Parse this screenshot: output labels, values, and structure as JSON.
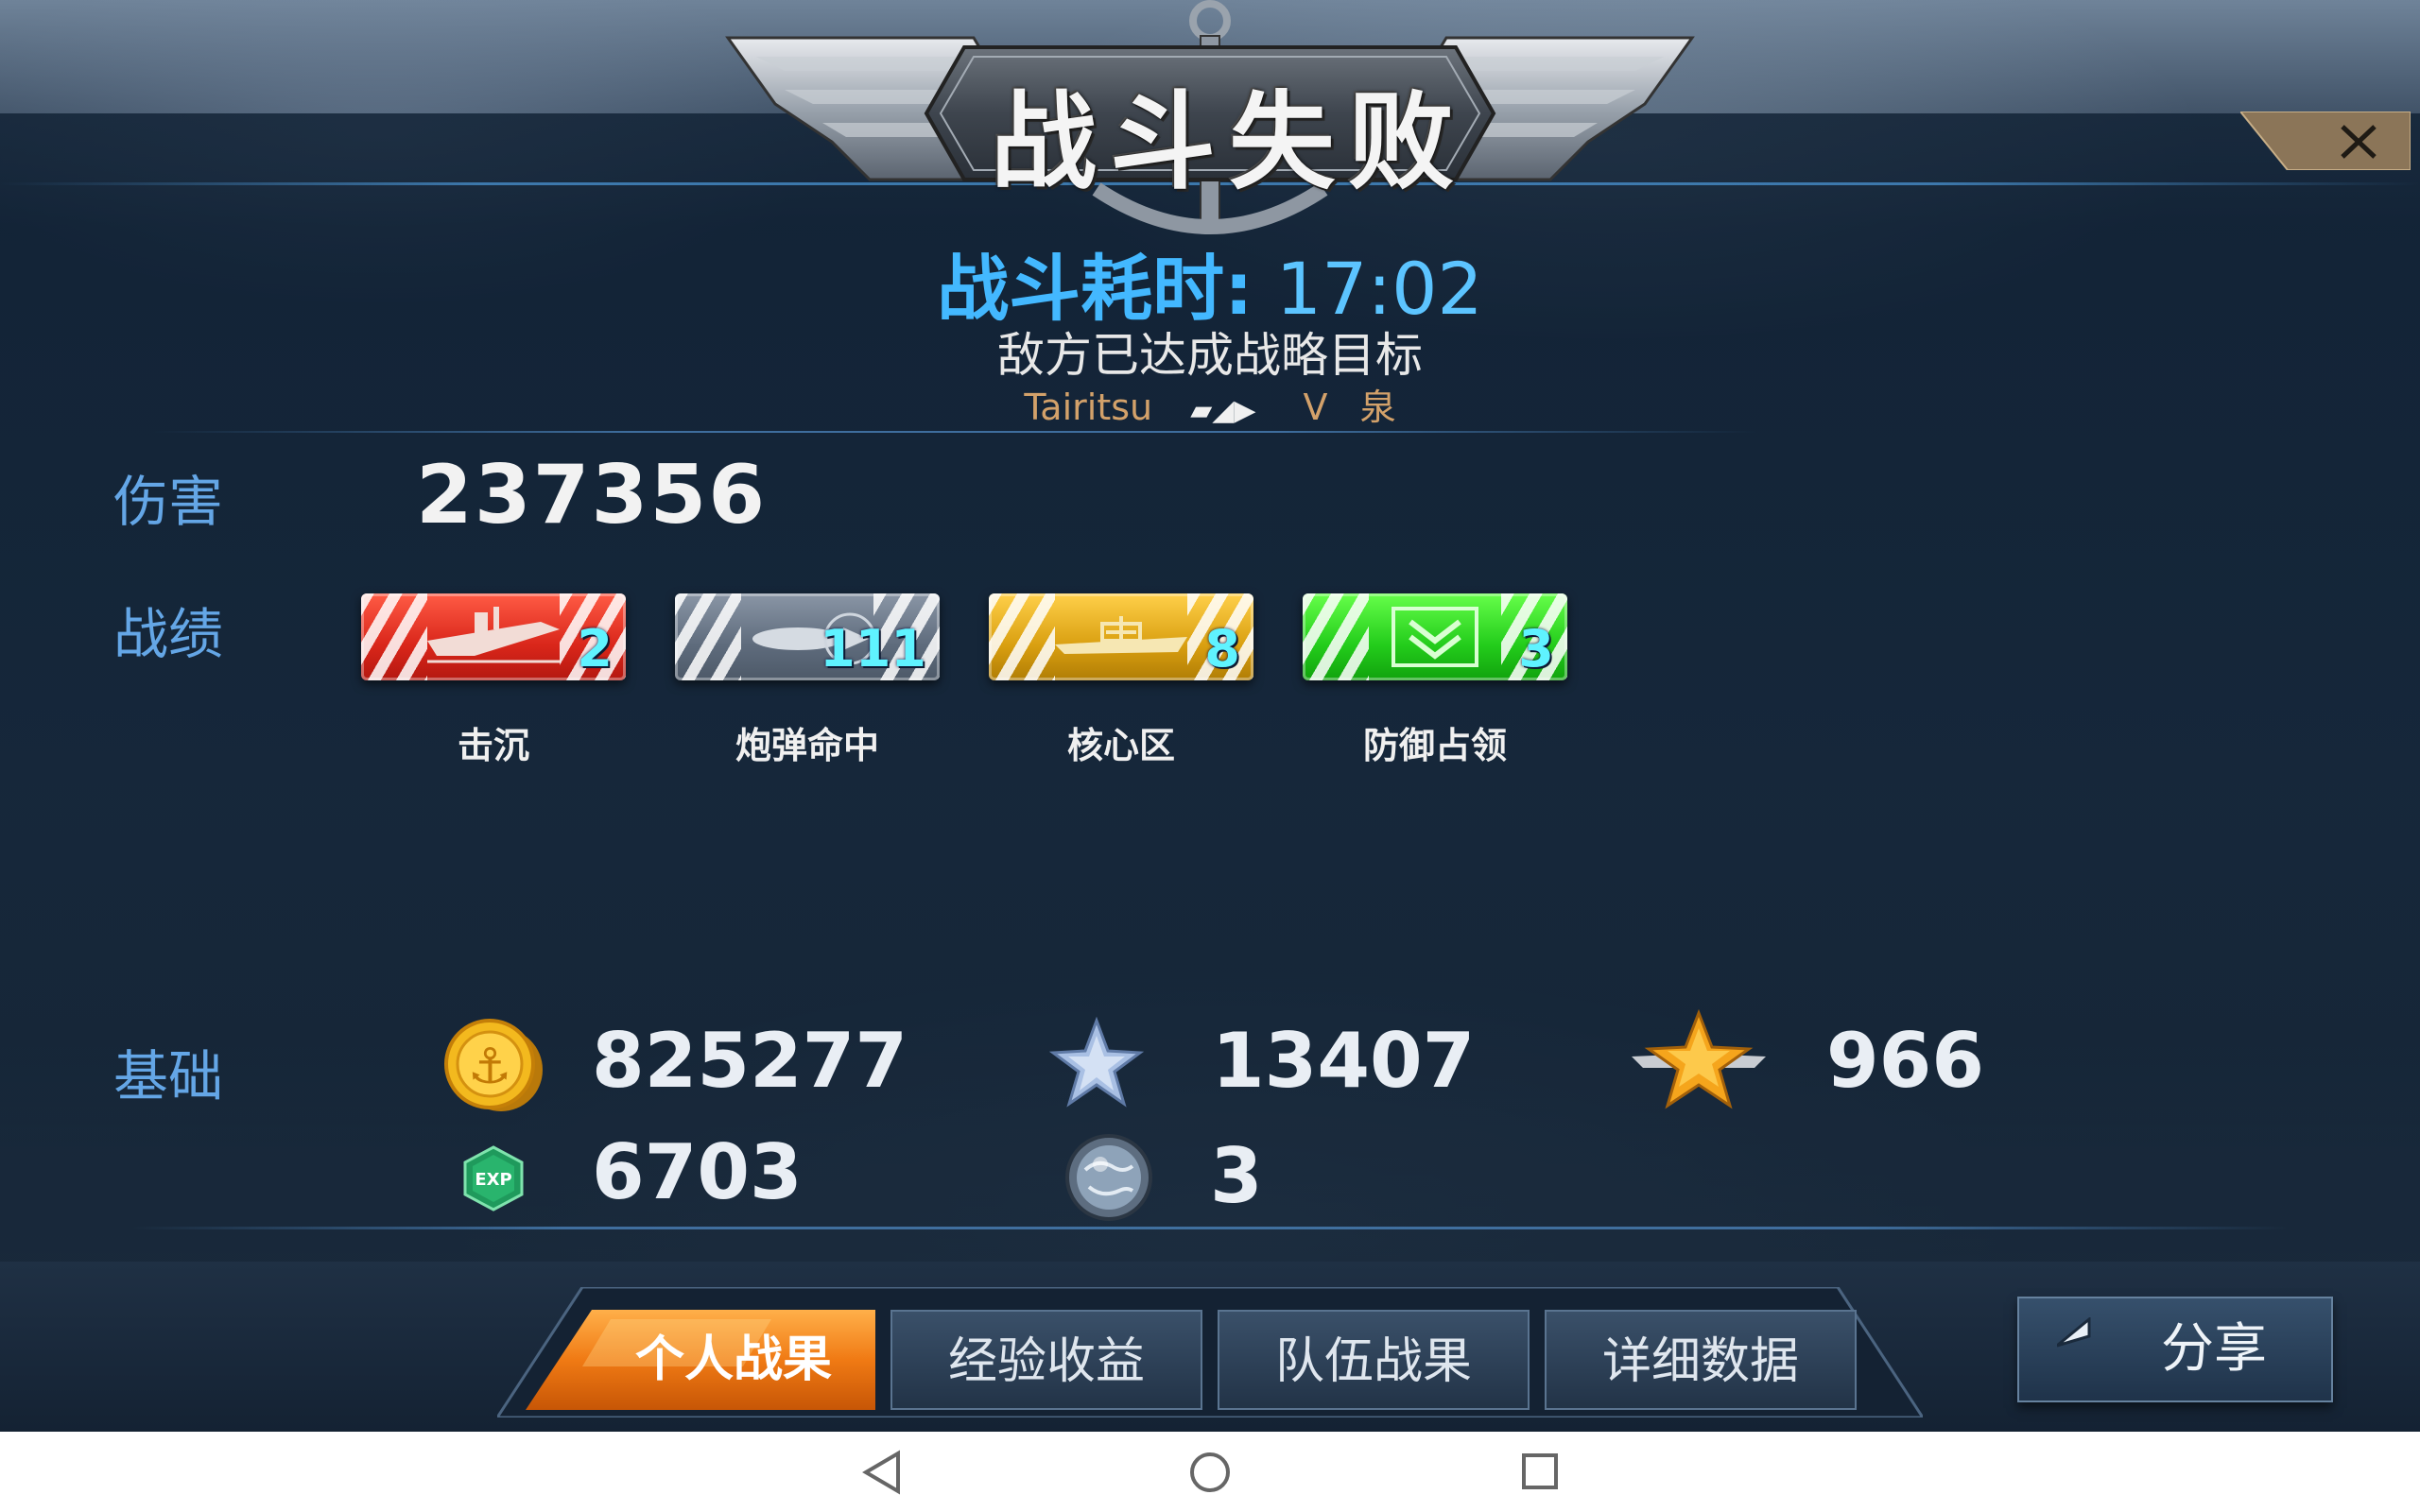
{
  "header": {
    "title": "战斗失败"
  },
  "battle": {
    "duration_label": "战斗耗时:",
    "duration_value": "17:02",
    "result_reason": "敌方已达成战略目标",
    "player_name": "Tairitsu",
    "vs_label": "V",
    "opponent_name": "泉"
  },
  "damage": {
    "label": "伤害",
    "value": "237356"
  },
  "achievements": {
    "label": "战绩",
    "items": [
      {
        "name": "击沉",
        "count": "2",
        "color": "#e0281c",
        "icon": "sinking-ship-icon"
      },
      {
        "name": "炮弹命中",
        "count": "111",
        "color": "#6a7686",
        "icon": "shell-hit-icon"
      },
      {
        "name": "核心区",
        "count": "8",
        "color": "#e1a714",
        "icon": "core-zone-icon"
      },
      {
        "name": "防御占领",
        "count": "3",
        "color": "#2ad21f",
        "icon": "defense-capture-icon"
      }
    ]
  },
  "basics": {
    "label": "基础",
    "gold": {
      "icon": "gold-coin-icon",
      "value": "825277"
    },
    "silver_star": {
      "icon": "silver-star-icon",
      "value": "13407"
    },
    "gold_star": {
      "icon": "gold-winged-star-icon",
      "value": "966"
    },
    "exp": {
      "icon": "exp-gem-icon",
      "value": "6703",
      "icon_text": "EXP"
    },
    "globe": {
      "icon": "globe-icon",
      "value": "3"
    }
  },
  "tabs": [
    {
      "label": "个人战果",
      "active": true
    },
    {
      "label": "经验收益",
      "active": false
    },
    {
      "label": "队伍战果",
      "active": false
    },
    {
      "label": "详细数据",
      "active": false
    }
  ],
  "share_button": {
    "label": "分享"
  },
  "colors": {
    "accent_blue": "#43b8ff",
    "label_blue": "#64a6e6",
    "player_name": "#d3a16a",
    "active_tab": "#f08a1c"
  }
}
